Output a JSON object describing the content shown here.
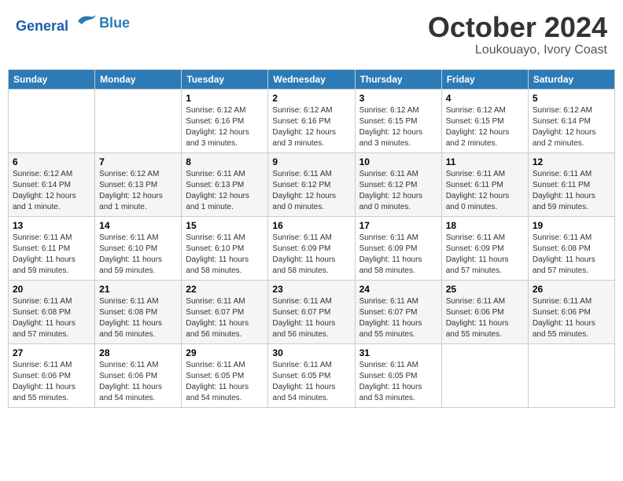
{
  "header": {
    "logo_line1": "General",
    "logo_line2": "Blue",
    "month": "October 2024",
    "location": "Loukouayo, Ivory Coast"
  },
  "days_of_week": [
    "Sunday",
    "Monday",
    "Tuesday",
    "Wednesday",
    "Thursday",
    "Friday",
    "Saturday"
  ],
  "weeks": [
    [
      {
        "day": "",
        "info": ""
      },
      {
        "day": "",
        "info": ""
      },
      {
        "day": "1",
        "info": "Sunrise: 6:12 AM\nSunset: 6:16 PM\nDaylight: 12 hours and 3 minutes."
      },
      {
        "day": "2",
        "info": "Sunrise: 6:12 AM\nSunset: 6:16 PM\nDaylight: 12 hours and 3 minutes."
      },
      {
        "day": "3",
        "info": "Sunrise: 6:12 AM\nSunset: 6:15 PM\nDaylight: 12 hours and 3 minutes."
      },
      {
        "day": "4",
        "info": "Sunrise: 6:12 AM\nSunset: 6:15 PM\nDaylight: 12 hours and 2 minutes."
      },
      {
        "day": "5",
        "info": "Sunrise: 6:12 AM\nSunset: 6:14 PM\nDaylight: 12 hours and 2 minutes."
      }
    ],
    [
      {
        "day": "6",
        "info": "Sunrise: 6:12 AM\nSunset: 6:14 PM\nDaylight: 12 hours and 1 minute."
      },
      {
        "day": "7",
        "info": "Sunrise: 6:12 AM\nSunset: 6:13 PM\nDaylight: 12 hours and 1 minute."
      },
      {
        "day": "8",
        "info": "Sunrise: 6:11 AM\nSunset: 6:13 PM\nDaylight: 12 hours and 1 minute."
      },
      {
        "day": "9",
        "info": "Sunrise: 6:11 AM\nSunset: 6:12 PM\nDaylight: 12 hours and 0 minutes."
      },
      {
        "day": "10",
        "info": "Sunrise: 6:11 AM\nSunset: 6:12 PM\nDaylight: 12 hours and 0 minutes."
      },
      {
        "day": "11",
        "info": "Sunrise: 6:11 AM\nSunset: 6:11 PM\nDaylight: 12 hours and 0 minutes."
      },
      {
        "day": "12",
        "info": "Sunrise: 6:11 AM\nSunset: 6:11 PM\nDaylight: 11 hours and 59 minutes."
      }
    ],
    [
      {
        "day": "13",
        "info": "Sunrise: 6:11 AM\nSunset: 6:11 PM\nDaylight: 11 hours and 59 minutes."
      },
      {
        "day": "14",
        "info": "Sunrise: 6:11 AM\nSunset: 6:10 PM\nDaylight: 11 hours and 59 minutes."
      },
      {
        "day": "15",
        "info": "Sunrise: 6:11 AM\nSunset: 6:10 PM\nDaylight: 11 hours and 58 minutes."
      },
      {
        "day": "16",
        "info": "Sunrise: 6:11 AM\nSunset: 6:09 PM\nDaylight: 11 hours and 58 minutes."
      },
      {
        "day": "17",
        "info": "Sunrise: 6:11 AM\nSunset: 6:09 PM\nDaylight: 11 hours and 58 minutes."
      },
      {
        "day": "18",
        "info": "Sunrise: 6:11 AM\nSunset: 6:09 PM\nDaylight: 11 hours and 57 minutes."
      },
      {
        "day": "19",
        "info": "Sunrise: 6:11 AM\nSunset: 6:08 PM\nDaylight: 11 hours and 57 minutes."
      }
    ],
    [
      {
        "day": "20",
        "info": "Sunrise: 6:11 AM\nSunset: 6:08 PM\nDaylight: 11 hours and 57 minutes."
      },
      {
        "day": "21",
        "info": "Sunrise: 6:11 AM\nSunset: 6:08 PM\nDaylight: 11 hours and 56 minutes."
      },
      {
        "day": "22",
        "info": "Sunrise: 6:11 AM\nSunset: 6:07 PM\nDaylight: 11 hours and 56 minutes."
      },
      {
        "day": "23",
        "info": "Sunrise: 6:11 AM\nSunset: 6:07 PM\nDaylight: 11 hours and 56 minutes."
      },
      {
        "day": "24",
        "info": "Sunrise: 6:11 AM\nSunset: 6:07 PM\nDaylight: 11 hours and 55 minutes."
      },
      {
        "day": "25",
        "info": "Sunrise: 6:11 AM\nSunset: 6:06 PM\nDaylight: 11 hours and 55 minutes."
      },
      {
        "day": "26",
        "info": "Sunrise: 6:11 AM\nSunset: 6:06 PM\nDaylight: 11 hours and 55 minutes."
      }
    ],
    [
      {
        "day": "27",
        "info": "Sunrise: 6:11 AM\nSunset: 6:06 PM\nDaylight: 11 hours and 55 minutes."
      },
      {
        "day": "28",
        "info": "Sunrise: 6:11 AM\nSunset: 6:06 PM\nDaylight: 11 hours and 54 minutes."
      },
      {
        "day": "29",
        "info": "Sunrise: 6:11 AM\nSunset: 6:05 PM\nDaylight: 11 hours and 54 minutes."
      },
      {
        "day": "30",
        "info": "Sunrise: 6:11 AM\nSunset: 6:05 PM\nDaylight: 11 hours and 54 minutes."
      },
      {
        "day": "31",
        "info": "Sunrise: 6:11 AM\nSunset: 6:05 PM\nDaylight: 11 hours and 53 minutes."
      },
      {
        "day": "",
        "info": ""
      },
      {
        "day": "",
        "info": ""
      }
    ]
  ]
}
